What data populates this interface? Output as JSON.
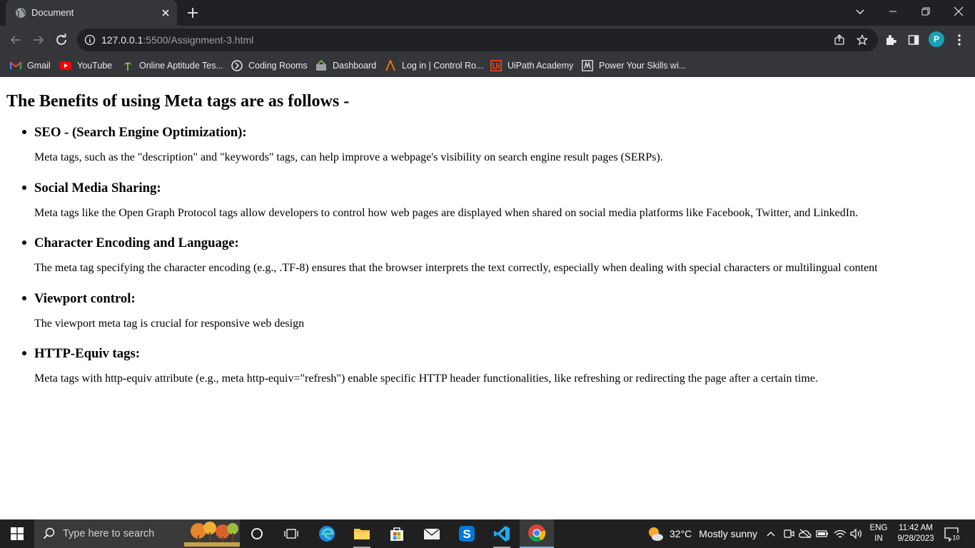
{
  "browser": {
    "tab": {
      "title": "Document",
      "close_icon": "close-icon",
      "favicon": "globe-icon"
    },
    "url": {
      "host": "127.0.0.1",
      "path": ":5500/Assignment-3.html"
    },
    "avatar_letter": "P",
    "bookmarks": [
      {
        "label": "Gmail",
        "icon": "gmail-icon"
      },
      {
        "label": "YouTube",
        "icon": "youtube-icon"
      },
      {
        "label": "Online Aptitude Tes...",
        "icon": "tree-icon"
      },
      {
        "label": "Coding Rooms",
        "icon": "coding-rooms-icon"
      },
      {
        "label": "Dashboard",
        "icon": "dashboard-icon"
      },
      {
        "label": "Log in | Control Ro...",
        "icon": "control-room-icon"
      },
      {
        "label": "UiPath Academy",
        "icon": "uipath-icon"
      },
      {
        "label": "Power Your Skills wi...",
        "icon": "power-skills-icon"
      }
    ]
  },
  "page": {
    "heading": "The Benefits of using Meta tags are as follows -",
    "items": [
      {
        "title": "SEO - (Search Engine Optimization):",
        "text": "Meta tags, such as the \"description\" and \"keywords\" tags, can help improve a webpage's visibility on search engine result pages (SERPs)."
      },
      {
        "title": "Social Media Sharing:",
        "text": "Meta tags like the Open Graph Protocol tags allow developers to control how web pages are displayed when shared on social media platforms like Facebook, Twitter, and LinkedIn."
      },
      {
        "title": "Character Encoding and Language:",
        "text": "The meta tag specifying the character encoding (e.g., .TF-8) ensures that the browser interprets the text correctly, especially when dealing with special characters or multilingual content"
      },
      {
        "title": "Viewport control:",
        "text": "The viewport meta tag is crucial for responsive web design"
      },
      {
        "title": "HTTP-Equiv tags:",
        "text": "Meta tags with http-equiv attribute (e.g., meta http-equiv=\"refresh\") enable specific HTTP header functionalities, like refreshing or redirecting the page after a certain time."
      }
    ]
  },
  "taskbar": {
    "search_placeholder": "Type here to search",
    "weather": {
      "temp": "32°C",
      "condition": "Mostly sunny"
    },
    "lang": {
      "line1": "ENG",
      "line2": "IN"
    },
    "clock": {
      "time": "11:42 AM",
      "date": "9/28/2023"
    },
    "notification_count": "10"
  },
  "colors": {
    "accent": "#76b9ed",
    "avatar": "#17a2b8",
    "chrome_dark": "#202124",
    "chrome_toolbar": "#35363a"
  }
}
